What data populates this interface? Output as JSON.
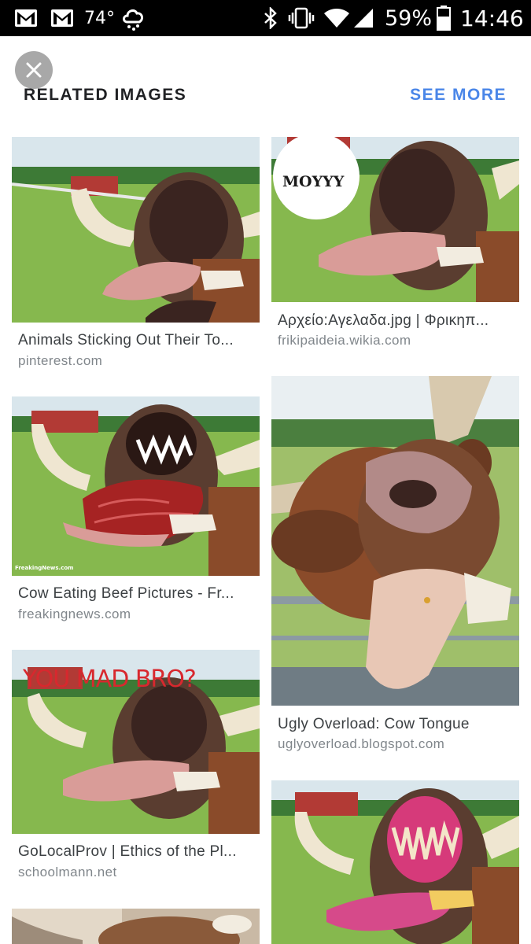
{
  "status_bar": {
    "temperature": "74°",
    "battery": "59%",
    "time": "14:46",
    "icons": [
      "gmail-icon",
      "gmail-icon",
      "weather-cloud-icon",
      "bluetooth-icon",
      "vibrate-icon",
      "wifi-icon",
      "cell-signal-icon",
      "battery-icon"
    ]
  },
  "header": {
    "title": "RELATED IMAGES",
    "see_more": "SEE MORE",
    "accent_color": "#4a86e8"
  },
  "results": [
    {
      "caption": "Animals Sticking Out Their To...",
      "source": "pinterest.com"
    },
    {
      "caption": "Αρχείο:Αγελαδα.jpg | Φρικηπ...",
      "source": "frikipaideia.wikia.com",
      "overlay": "MOYYY"
    },
    {
      "caption": "Cow Eating Beef Pictures - Fr...",
      "source": "freakingnews.com",
      "overlay": "FreakingNews.com"
    },
    {
      "caption": "Ugly Overload: Cow Tongue",
      "source": "uglyoverload.blogspot.com"
    },
    {
      "caption": "GoLocalProv | Ethics of the Pl...",
      "source": "schoolmann.net",
      "overlay": "YOU MAD BRO?"
    },
    {
      "caption": "",
      "source": ""
    },
    {
      "caption": "",
      "source": ""
    }
  ]
}
